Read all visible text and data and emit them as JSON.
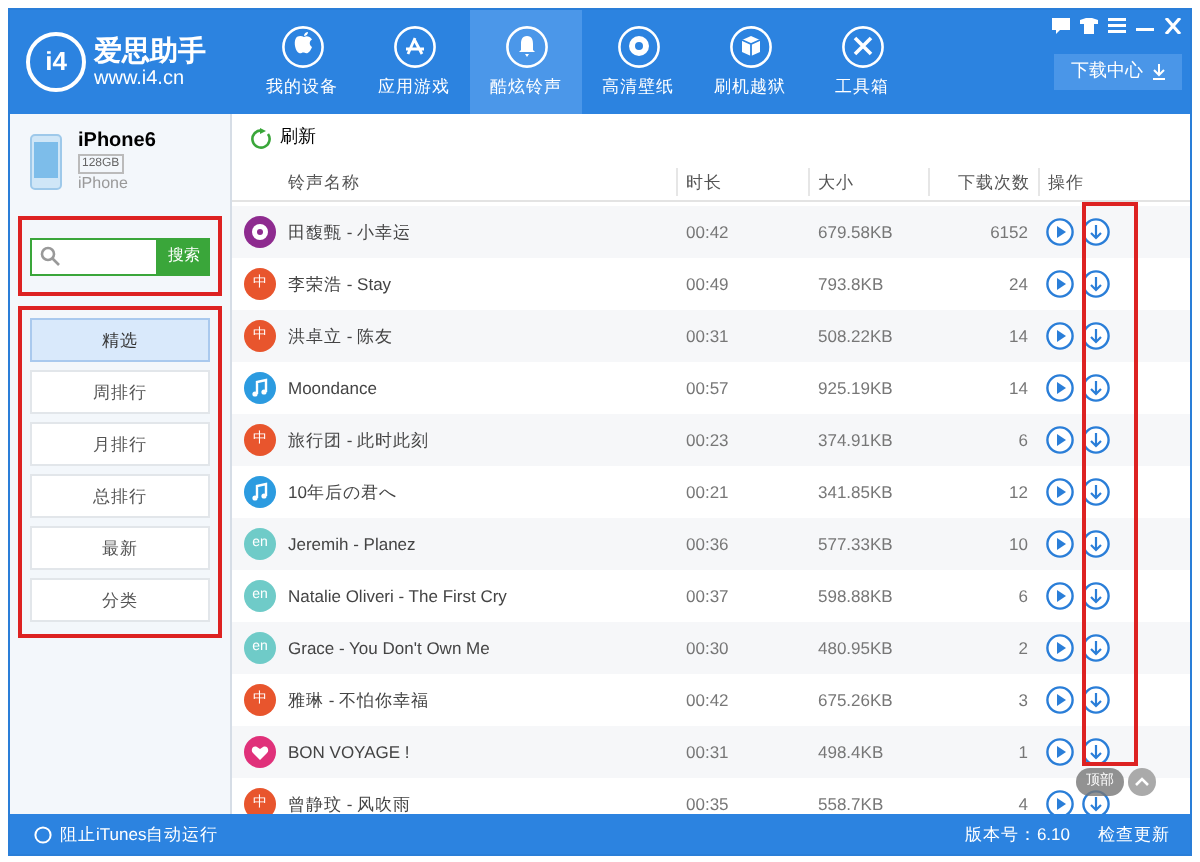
{
  "logo": {
    "name": "爱思助手",
    "url": "www.i4.cn",
    "badge": "i4"
  },
  "nav_tabs": [
    {
      "label": "我的设备",
      "selected": false
    },
    {
      "label": "应用游戏",
      "selected": false
    },
    {
      "label": "酷炫铃声",
      "selected": true
    },
    {
      "label": "高清壁纸",
      "selected": false
    },
    {
      "label": "刷机越狱",
      "selected": false
    },
    {
      "label": "工具箱",
      "selected": false
    }
  ],
  "download_center": "下载中心",
  "device": {
    "name": "iPhone6",
    "capacity": "128GB",
    "model": "iPhone"
  },
  "search": {
    "button": "搜索"
  },
  "sidebar_items": [
    {
      "label": "精选",
      "selected": true
    },
    {
      "label": "周排行",
      "selected": false
    },
    {
      "label": "月排行",
      "selected": false
    },
    {
      "label": "总排行",
      "selected": false
    },
    {
      "label": "最新",
      "selected": false
    },
    {
      "label": "分类",
      "selected": false
    }
  ],
  "refresh": "刷新",
  "columns": [
    "铃声名称",
    "时长",
    "大小",
    "下载次数",
    "操作"
  ],
  "rows": [
    {
      "icon": {
        "kind": "disc",
        "color": "#8e2b8f"
      },
      "name": "田馥甄 - 小幸运",
      "duration": "00:42",
      "size": "679.58KB",
      "downloads": "6152"
    },
    {
      "icon": {
        "kind": "text",
        "color": "#e8552d",
        "label": "中"
      },
      "name": "李荣浩 - Stay",
      "duration": "00:49",
      "size": "793.8KB",
      "downloads": "24"
    },
    {
      "icon": {
        "kind": "text",
        "color": "#e8552d",
        "label": "中"
      },
      "name": "洪卓立 - 陈友",
      "duration": "00:31",
      "size": "508.22KB",
      "downloads": "14"
    },
    {
      "icon": {
        "kind": "note",
        "color": "#2c9be0"
      },
      "name": "Moondance",
      "duration": "00:57",
      "size": "925.19KB",
      "downloads": "14"
    },
    {
      "icon": {
        "kind": "text",
        "color": "#e8552d",
        "label": "中"
      },
      "name": "旅行团 - 此时此刻",
      "duration": "00:23",
      "size": "374.91KB",
      "downloads": "6"
    },
    {
      "icon": {
        "kind": "note",
        "color": "#2c9be0"
      },
      "name": "10年后の君へ",
      "duration": "00:21",
      "size": "341.85KB",
      "downloads": "12"
    },
    {
      "icon": {
        "kind": "text",
        "color": "#6fcbc8",
        "label": "en"
      },
      "name": "Jeremih - Planez",
      "duration": "00:36",
      "size": "577.33KB",
      "downloads": "10"
    },
    {
      "icon": {
        "kind": "text",
        "color": "#6fcbc8",
        "label": "en"
      },
      "name": "Natalie Oliveri - The First Cry",
      "duration": "00:37",
      "size": "598.88KB",
      "downloads": "6"
    },
    {
      "icon": {
        "kind": "text",
        "color": "#6fcbc8",
        "label": "en"
      },
      "name": "Grace - You Don't Own Me",
      "duration": "00:30",
      "size": "480.95KB",
      "downloads": "2"
    },
    {
      "icon": {
        "kind": "text",
        "color": "#e8552d",
        "label": "中"
      },
      "name": "雅琳 - 不怕你幸福",
      "duration": "00:42",
      "size": "675.26KB",
      "downloads": "3"
    },
    {
      "icon": {
        "kind": "heart",
        "color": "#e0317a"
      },
      "name": "BON VOYAGE !",
      "duration": "00:31",
      "size": "498.4KB",
      "downloads": "1"
    },
    {
      "icon": {
        "kind": "text",
        "color": "#e8552d",
        "label": "中"
      },
      "name": "曾静玟 - 风吹雨",
      "duration": "00:35",
      "size": "558.7KB",
      "downloads": "4"
    }
  ],
  "back_to_top": "顶部",
  "status_bar": {
    "itunes": "阻止iTunes自动运行",
    "version": "版本号：6.10",
    "update": "检查更新"
  }
}
